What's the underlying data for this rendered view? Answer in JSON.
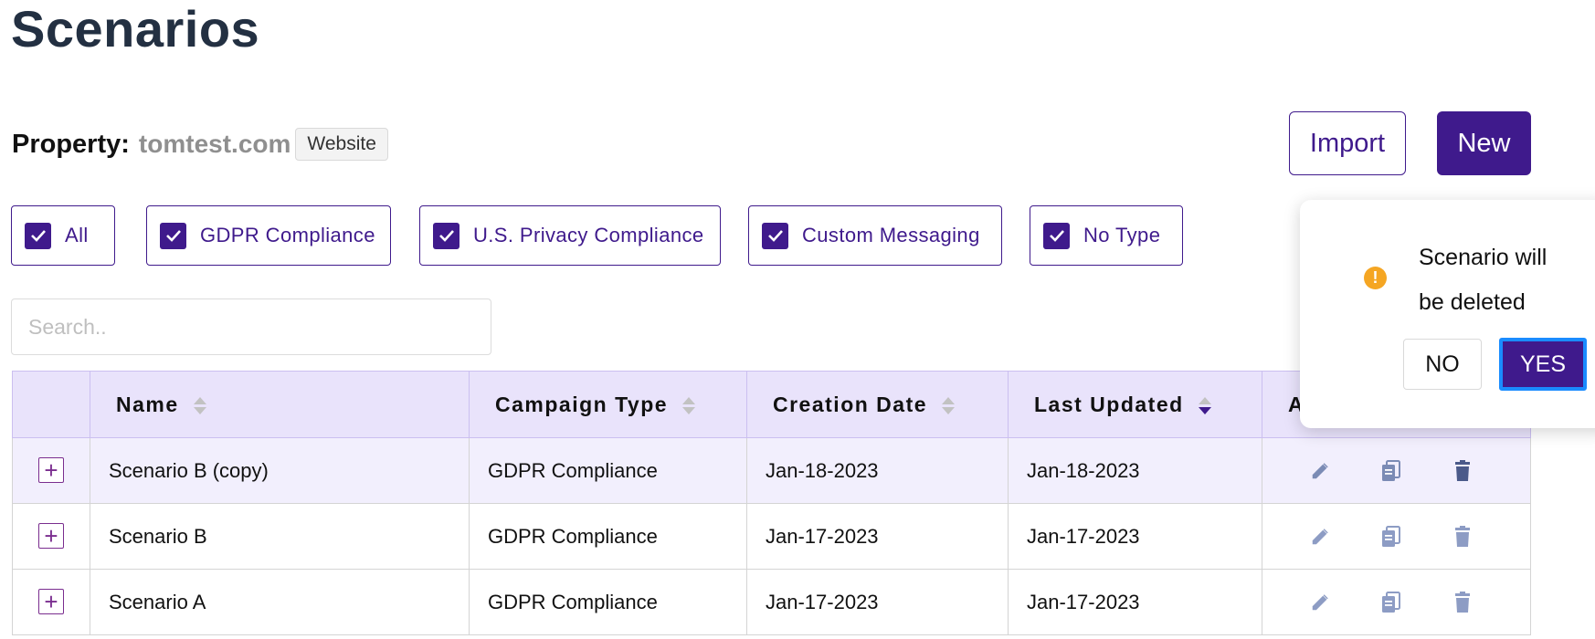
{
  "page": {
    "title": "Scenarios"
  },
  "property": {
    "label": "Property:",
    "value": "tomtest.com",
    "badge": "Website"
  },
  "toolbar": {
    "import_label": "Import",
    "new_label": "New"
  },
  "filters": [
    {
      "label": "All",
      "checked": true
    },
    {
      "label": "GDPR Compliance",
      "checked": true
    },
    {
      "label": "U.S. Privacy Compliance",
      "checked": true
    },
    {
      "label": "Custom Messaging",
      "checked": true
    },
    {
      "label": "No Type",
      "checked": true
    }
  ],
  "search": {
    "placeholder": "Search..",
    "value": ""
  },
  "table": {
    "headers": {
      "name": "Name",
      "campaign_type": "Campaign Type",
      "creation_date": "Creation Date",
      "last_updated": "Last Updated",
      "actions": "A"
    },
    "sorted_column": "Last Updated",
    "sort_direction": "descending",
    "rows": [
      {
        "name": "Scenario B (copy)",
        "campaign_type": "GDPR Compliance",
        "creation_date": "Jan-18-2023",
        "last_updated": "Jan-18-2023"
      },
      {
        "name": "Scenario B",
        "campaign_type": "GDPR Compliance",
        "creation_date": "Jan-17-2023",
        "last_updated": "Jan-17-2023"
      },
      {
        "name": "Scenario A",
        "campaign_type": "GDPR Compliance",
        "creation_date": "Jan-17-2023",
        "last_updated": "Jan-17-2023"
      }
    ]
  },
  "popover": {
    "icon": "exclamation-circle-icon",
    "message": "Scenario will be deleted",
    "no_label": "NO",
    "yes_label": "YES"
  },
  "colors": {
    "accent": "#3f1a8c",
    "header_bg": "#e9e3fb",
    "warning": "#f5a623",
    "focus_ring": "#1a8cff"
  }
}
